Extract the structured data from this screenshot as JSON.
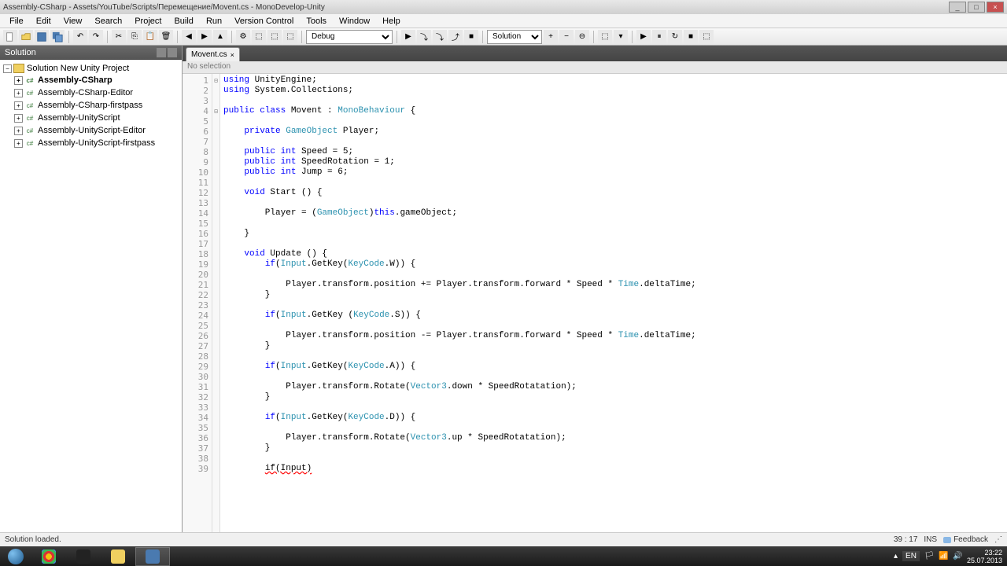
{
  "window": {
    "title": "Assembly-CSharp - Assets/YouTube/Scripts/Перемещение/Movent.cs - MonoDevelop-Unity"
  },
  "menu": [
    "File",
    "Edit",
    "View",
    "Search",
    "Project",
    "Build",
    "Run",
    "Version Control",
    "Tools",
    "Window",
    "Help"
  ],
  "toolbar": {
    "debug_label": "Debug",
    "solution_label": "Solution"
  },
  "sidebar": {
    "title": "Solution",
    "root": "Solution New Unity Project",
    "items": [
      {
        "label": "Assembly-CSharp",
        "bold": true
      },
      {
        "label": "Assembly-CSharp-Editor",
        "bold": false
      },
      {
        "label": "Assembly-CSharp-firstpass",
        "bold": false
      },
      {
        "label": "Assembly-UnityScript",
        "bold": false
      },
      {
        "label": "Assembly-UnityScript-Editor",
        "bold": false
      },
      {
        "label": "Assembly-UnityScript-firstpass",
        "bold": false
      }
    ]
  },
  "editor": {
    "tab": "Movent.cs",
    "breadcrumb": "No selection",
    "lines": [
      {
        "n": 1,
        "tokens": [
          {
            "t": "using ",
            "c": "kw"
          },
          {
            "t": "UnityEngine;",
            "c": ""
          }
        ]
      },
      {
        "n": 2,
        "tokens": [
          {
            "t": "using ",
            "c": "kw"
          },
          {
            "t": "System.Collections;",
            "c": ""
          }
        ]
      },
      {
        "n": 3,
        "tokens": []
      },
      {
        "n": 4,
        "tokens": [
          {
            "t": "public class ",
            "c": "kw"
          },
          {
            "t": "Movent",
            "c": ""
          },
          {
            "t": " : ",
            "c": ""
          },
          {
            "t": "MonoBehaviour",
            "c": "ty"
          },
          {
            "t": " {",
            "c": ""
          }
        ]
      },
      {
        "n": 5,
        "tokens": []
      },
      {
        "n": 6,
        "tokens": [
          {
            "t": "    ",
            "c": ""
          },
          {
            "t": "private ",
            "c": "kw"
          },
          {
            "t": "GameObject",
            "c": "ty"
          },
          {
            "t": " Player;",
            "c": ""
          }
        ]
      },
      {
        "n": 7,
        "tokens": []
      },
      {
        "n": 8,
        "tokens": [
          {
            "t": "    ",
            "c": ""
          },
          {
            "t": "public int ",
            "c": "kw"
          },
          {
            "t": "Speed = 5;",
            "c": ""
          }
        ]
      },
      {
        "n": 9,
        "tokens": [
          {
            "t": "    ",
            "c": ""
          },
          {
            "t": "public int ",
            "c": "kw"
          },
          {
            "t": "SpeedRotation = 1;",
            "c": ""
          }
        ]
      },
      {
        "n": 10,
        "tokens": [
          {
            "t": "    ",
            "c": ""
          },
          {
            "t": "public int ",
            "c": "kw"
          },
          {
            "t": "Jump = 6;",
            "c": ""
          }
        ]
      },
      {
        "n": 11,
        "tokens": []
      },
      {
        "n": 12,
        "tokens": [
          {
            "t": "    ",
            "c": ""
          },
          {
            "t": "void ",
            "c": "kw"
          },
          {
            "t": "Start () {",
            "c": ""
          }
        ]
      },
      {
        "n": 13,
        "tokens": []
      },
      {
        "n": 14,
        "tokens": [
          {
            "t": "        Player = (",
            "c": ""
          },
          {
            "t": "GameObject",
            "c": "ty"
          },
          {
            "t": ")",
            "c": ""
          },
          {
            "t": "this",
            "c": "kw"
          },
          {
            "t": ".gameObject;",
            "c": ""
          }
        ]
      },
      {
        "n": 15,
        "tokens": []
      },
      {
        "n": 16,
        "tokens": [
          {
            "t": "    }",
            "c": ""
          }
        ]
      },
      {
        "n": 17,
        "tokens": []
      },
      {
        "n": 18,
        "tokens": [
          {
            "t": "    ",
            "c": ""
          },
          {
            "t": "void ",
            "c": "kw"
          },
          {
            "t": "Update () {",
            "c": ""
          }
        ]
      },
      {
        "n": 19,
        "tokens": [
          {
            "t": "        ",
            "c": ""
          },
          {
            "t": "if",
            "c": "kw"
          },
          {
            "t": "(",
            "c": ""
          },
          {
            "t": "Input",
            "c": "ty"
          },
          {
            "t": ".GetKey(",
            "c": ""
          },
          {
            "t": "KeyCode",
            "c": "ty"
          },
          {
            "t": ".W)) {",
            "c": ""
          }
        ]
      },
      {
        "n": 20,
        "tokens": []
      },
      {
        "n": 21,
        "tokens": [
          {
            "t": "            Player.transform.position += Player.transform.forward * Speed * ",
            "c": ""
          },
          {
            "t": "Time",
            "c": "ty"
          },
          {
            "t": ".deltaTime;",
            "c": ""
          }
        ]
      },
      {
        "n": 22,
        "tokens": [
          {
            "t": "        }",
            "c": ""
          }
        ]
      },
      {
        "n": 23,
        "tokens": []
      },
      {
        "n": 24,
        "tokens": [
          {
            "t": "        ",
            "c": ""
          },
          {
            "t": "if",
            "c": "kw"
          },
          {
            "t": "(",
            "c": ""
          },
          {
            "t": "Input",
            "c": "ty"
          },
          {
            "t": ".GetKey (",
            "c": ""
          },
          {
            "t": "KeyCode",
            "c": "ty"
          },
          {
            "t": ".S)) {",
            "c": ""
          }
        ]
      },
      {
        "n": 25,
        "tokens": []
      },
      {
        "n": 26,
        "tokens": [
          {
            "t": "            Player.transform.position -= Player.transform.forward * Speed * ",
            "c": ""
          },
          {
            "t": "Time",
            "c": "ty"
          },
          {
            "t": ".deltaTime;",
            "c": ""
          }
        ]
      },
      {
        "n": 27,
        "tokens": [
          {
            "t": "        }",
            "c": ""
          }
        ]
      },
      {
        "n": 28,
        "tokens": []
      },
      {
        "n": 29,
        "tokens": [
          {
            "t": "        ",
            "c": ""
          },
          {
            "t": "if",
            "c": "kw"
          },
          {
            "t": "(",
            "c": ""
          },
          {
            "t": "Input",
            "c": "ty"
          },
          {
            "t": ".GetKey(",
            "c": ""
          },
          {
            "t": "KeyCode",
            "c": "ty"
          },
          {
            "t": ".A)) {",
            "c": ""
          }
        ]
      },
      {
        "n": 30,
        "tokens": []
      },
      {
        "n": 31,
        "tokens": [
          {
            "t": "            Player.transform.Rotate(",
            "c": ""
          },
          {
            "t": "Vector3",
            "c": "ty"
          },
          {
            "t": ".down * SpeedRotatation);",
            "c": ""
          }
        ]
      },
      {
        "n": 32,
        "tokens": [
          {
            "t": "        }",
            "c": ""
          }
        ]
      },
      {
        "n": 33,
        "tokens": []
      },
      {
        "n": 34,
        "tokens": [
          {
            "t": "        ",
            "c": ""
          },
          {
            "t": "if",
            "c": "kw"
          },
          {
            "t": "(",
            "c": ""
          },
          {
            "t": "Input",
            "c": "ty"
          },
          {
            "t": ".GetKey(",
            "c": ""
          },
          {
            "t": "KeyCode",
            "c": "ty"
          },
          {
            "t": ".D)) {",
            "c": ""
          }
        ]
      },
      {
        "n": 35,
        "tokens": []
      },
      {
        "n": 36,
        "tokens": [
          {
            "t": "            Player.transform.Rotate(",
            "c": ""
          },
          {
            "t": "Vector3",
            "c": "ty"
          },
          {
            "t": ".up * SpeedRotatation);",
            "c": ""
          }
        ]
      },
      {
        "n": 37,
        "tokens": [
          {
            "t": "        }",
            "c": ""
          }
        ]
      },
      {
        "n": 38,
        "tokens": []
      },
      {
        "n": 39,
        "tokens": [
          {
            "t": "        ",
            "c": ""
          },
          {
            "t": "if(Input)",
            "c": "err"
          }
        ]
      }
    ]
  },
  "status": {
    "message": "Solution loaded.",
    "cursor": "39 : 17",
    "mode": "INS",
    "feedback": "Feedback"
  },
  "taskbar": {
    "lang": "EN",
    "time": "23:22",
    "date": "25.07.2013"
  }
}
